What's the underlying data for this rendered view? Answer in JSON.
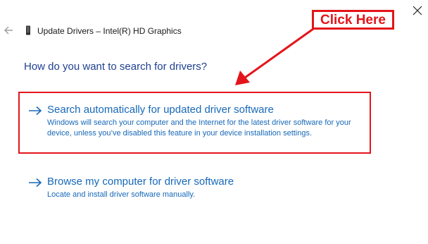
{
  "window": {
    "title": "Update Drivers – Intel(R) HD Graphics"
  },
  "heading": "How do you want to search for drivers?",
  "options": [
    {
      "title": "Search automatically for updated driver software",
      "description": "Windows will search your computer and the Internet for the latest driver software for your device, unless you’ve disabled this feature in your device installation settings."
    },
    {
      "title": "Browse my computer for driver software",
      "description": "Locate and install driver software manually."
    }
  ],
  "annotation": {
    "label": "Click Here",
    "color": "#e3151a"
  },
  "colors": {
    "link": "#1668b8",
    "heading": "#1e3f91",
    "annotation": "#e3151a"
  },
  "icons": {
    "back": "back-arrow-icon",
    "device": "device-icon",
    "close": "close-icon",
    "option": "right-arrow-icon"
  }
}
